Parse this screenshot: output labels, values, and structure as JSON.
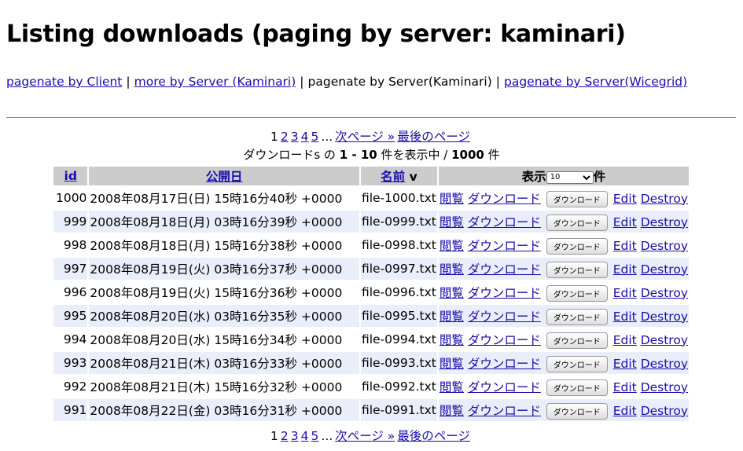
{
  "title": "Listing downloads (paging by server: kaminari)",
  "nav": {
    "link1": "pagenate by Client",
    "link2": "more by Server (Kaminari)",
    "current": "pagenate by Server(Kaminari)",
    "link3": "pagenate by Server(Wicegrid)",
    "sep": "|"
  },
  "pager": {
    "current": "1",
    "pages": [
      "2",
      "3",
      "4",
      "5"
    ],
    "ellipsis": "...",
    "next": "次ページ »",
    "last": "最後のページ"
  },
  "summary": {
    "prefix": "ダウンロードs の",
    "range": "1 - 10",
    "middle": "件を表示中 /",
    "total": "1000",
    "suffix": "件"
  },
  "table": {
    "headers": {
      "id": "id",
      "date": "公開日",
      "name": "名前",
      "sort_mark": "v",
      "show": "表示",
      "unit": "件"
    },
    "per_page": "10",
    "actions": {
      "show": "閲覧",
      "download_link": "ダウンロード",
      "download_button": "ダウンロード",
      "edit": "Edit",
      "destroy": "Destroy"
    },
    "rows": [
      {
        "id": "1000",
        "date": "2008年08月17日(日) 15時16分40秒 +0000",
        "name": "file-1000.txt"
      },
      {
        "id": "999",
        "date": "2008年08月18日(月) 03時16分39秒 +0000",
        "name": "file-0999.txt"
      },
      {
        "id": "998",
        "date": "2008年08月18日(月) 15時16分38秒 +0000",
        "name": "file-0998.txt"
      },
      {
        "id": "997",
        "date": "2008年08月19日(火) 03時16分37秒 +0000",
        "name": "file-0997.txt"
      },
      {
        "id": "996",
        "date": "2008年08月19日(火) 15時16分36秒 +0000",
        "name": "file-0996.txt"
      },
      {
        "id": "995",
        "date": "2008年08月20日(水) 03時16分35秒 +0000",
        "name": "file-0995.txt"
      },
      {
        "id": "994",
        "date": "2008年08月20日(水) 15時16分34秒 +0000",
        "name": "file-0994.txt"
      },
      {
        "id": "993",
        "date": "2008年08月21日(木) 03時16分33秒 +0000",
        "name": "file-0993.txt"
      },
      {
        "id": "992",
        "date": "2008年08月21日(木) 15時16分32秒 +0000",
        "name": "file-0992.txt"
      },
      {
        "id": "991",
        "date": "2008年08月22日(金) 03時16分31秒 +0000",
        "name": "file-0991.txt"
      }
    ]
  }
}
